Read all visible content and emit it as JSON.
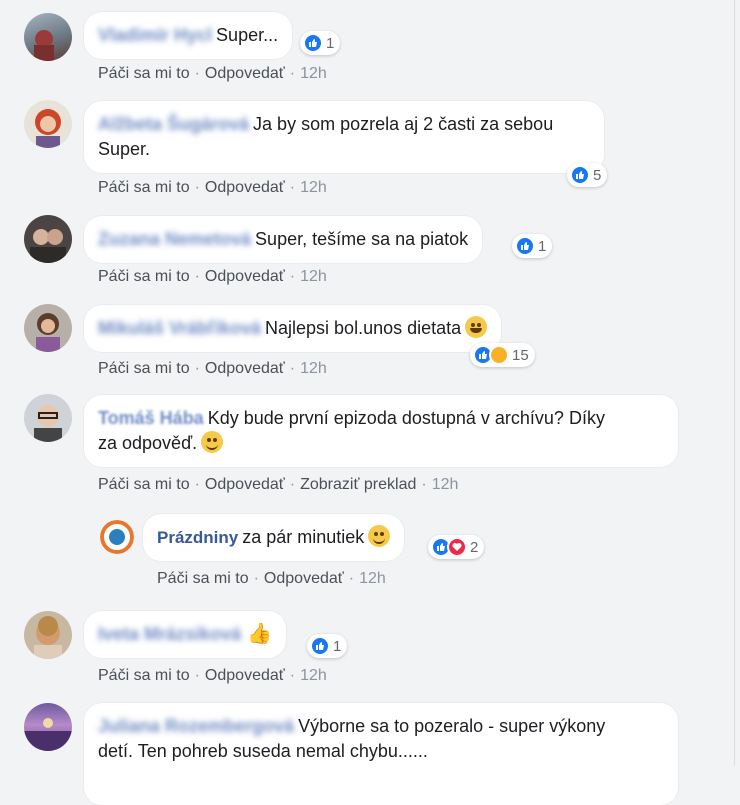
{
  "actions": {
    "like": "Páči sa mi to",
    "reply": "Odpovedať",
    "translate": "Zobraziť preklad",
    "time": "12h"
  },
  "comments": [
    {
      "author": "Vladimír Hycl",
      "text": "Super...",
      "reacts": "1"
    },
    {
      "author": "Alžbeta Šugárová",
      "text": "Ja by som pozrela aj 2 časti za sebou",
      "text2": "Super.",
      "reacts": "5"
    },
    {
      "author": "Zuzana Nemetová",
      "text": "Super, tešíme sa na piatok",
      "reacts": "1"
    },
    {
      "author": "Mikuláš Vrábľiková",
      "text": "Najlepsi bol.unos dietata",
      "reacts": "15"
    },
    {
      "author": "Tomáš Hába",
      "text": "Kdy bude první epizoda dostupná v archívu? Díky",
      "text2": "za odpověď.",
      "reacts": ""
    },
    {
      "author": "Prázdniny",
      "text": "za pár minutiek",
      "reacts": "2"
    },
    {
      "author": "Iveta Mrázsiková",
      "text": "",
      "reacts": "1"
    },
    {
      "author": "Juliana Rozembergová",
      "text": "Výborne sa to pozeralo - super výkony",
      "text2": "detí. Ten pohreb suseda nemal chybu......",
      "reacts": ""
    }
  ],
  "colors": {
    "like": "#1877f2",
    "love": "#f02849",
    "haha": "#f7b125",
    "link": "#385898"
  }
}
